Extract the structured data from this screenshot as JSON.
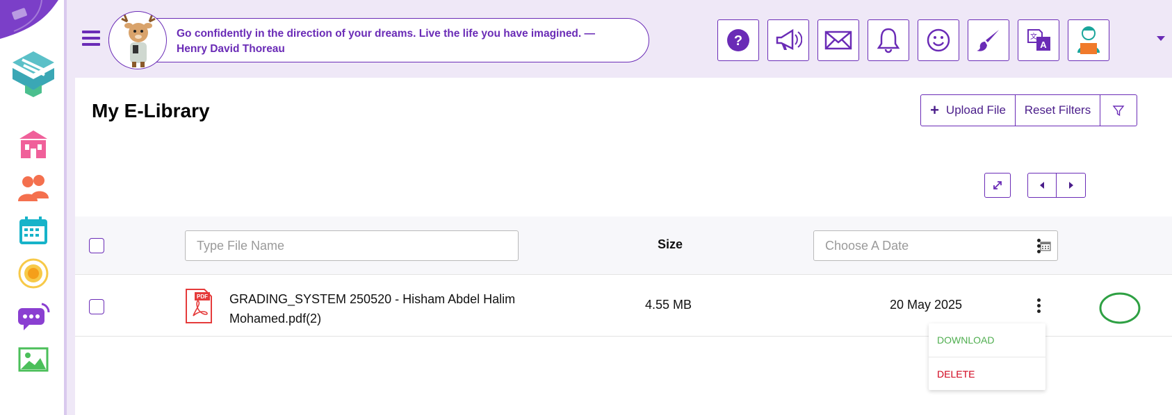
{
  "header": {
    "quote_line1": "Go confidently in the direction of your dreams. Live the life you have imagined. —",
    "quote_line2": "Henry David Thoreau",
    "icons": [
      "help-icon",
      "megaphone-icon",
      "mail-icon",
      "bell-icon",
      "smiley-icon",
      "brush-icon",
      "translate-icon",
      "user-avatar"
    ]
  },
  "sidebar": {
    "icons": [
      "school-icon",
      "people-icon",
      "calendar-icon",
      "target-icon",
      "chat-icon",
      "image-icon"
    ]
  },
  "page": {
    "title": "My E-Library",
    "upload_label": "Upload File",
    "reset_label": "Reset Filters"
  },
  "table": {
    "file_name_placeholder": "Type File Name",
    "size_header": "Size",
    "date_placeholder": "Choose A Date",
    "rows": [
      {
        "name_line1": "GRADING_SYSTEM 250520 - Hisham Abdel Halim",
        "name_line2": "Mohamed.pdf(2)",
        "size": "4.55 MB",
        "date": "20 May 2025",
        "pdf_badge": "PDF"
      }
    ]
  },
  "menu": {
    "download": "DOWNLOAD",
    "delete": "DELETE"
  },
  "colors": {
    "brand": "#6a2bb6",
    "download": "#4fae4f",
    "delete": "#d0021b",
    "annotation": "#2ea043"
  }
}
